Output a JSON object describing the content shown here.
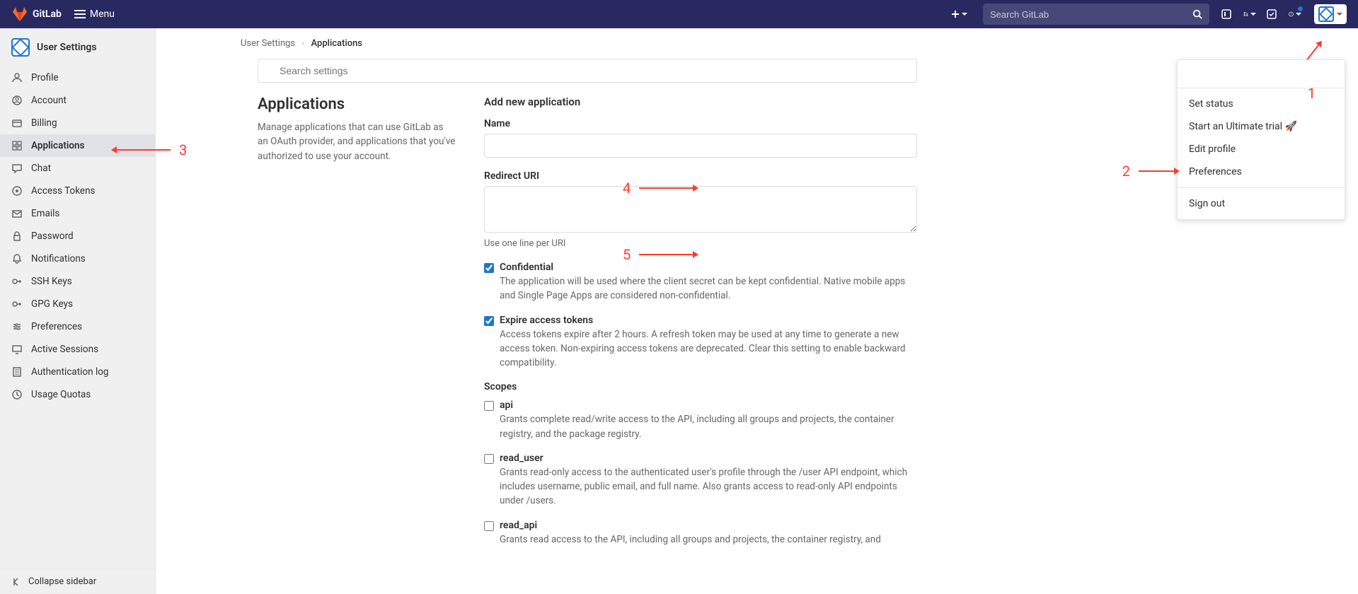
{
  "brand": "GitLab",
  "menu_label": "Menu",
  "search_placeholder": "Search GitLab",
  "sidebar": {
    "title": "User Settings",
    "items": [
      {
        "label": "Profile",
        "icon": "profile"
      },
      {
        "label": "Account",
        "icon": "account"
      },
      {
        "label": "Billing",
        "icon": "billing"
      },
      {
        "label": "Applications",
        "icon": "applications",
        "active": true
      },
      {
        "label": "Chat",
        "icon": "chat"
      },
      {
        "label": "Access Tokens",
        "icon": "token"
      },
      {
        "label": "Emails",
        "icon": "email"
      },
      {
        "label": "Password",
        "icon": "lock"
      },
      {
        "label": "Notifications",
        "icon": "bell"
      },
      {
        "label": "SSH Keys",
        "icon": "key"
      },
      {
        "label": "GPG Keys",
        "icon": "key"
      },
      {
        "label": "Preferences",
        "icon": "prefs"
      },
      {
        "label": "Active Sessions",
        "icon": "monitor"
      },
      {
        "label": "Authentication log",
        "icon": "list"
      },
      {
        "label": "Usage Quotas",
        "icon": "quota"
      }
    ],
    "collapse": "Collapse sidebar"
  },
  "breadcrumb": {
    "parent": "User Settings",
    "current": "Applications"
  },
  "search_settings_placeholder": "Search settings",
  "page": {
    "title": "Applications",
    "description": "Manage applications that can use GitLab as an OAuth provider, and applications that you've authorized to use your account.",
    "form_title": "Add new application",
    "name_label": "Name",
    "redirect_label": "Redirect URI",
    "redirect_hint": "Use one line per URI",
    "confidential": {
      "label": "Confidential",
      "desc": "The application will be used where the client secret can be kept confidential. Native mobile apps and Single Page Apps are considered non-confidential."
    },
    "expire": {
      "label": "Expire access tokens",
      "desc": "Access tokens expire after 2 hours. A refresh token may be used at any time to generate a new access token. Non-expiring access tokens are deprecated. Clear this setting to enable backward compatibility."
    },
    "scopes_title": "Scopes",
    "scopes": [
      {
        "name": "api",
        "desc": "Grants complete read/write access to the API, including all groups and projects, the container registry, and the package registry."
      },
      {
        "name": "read_user",
        "desc": "Grants read-only access to the authenticated user's profile through the /user API endpoint, which includes username, public email, and full name. Also grants access to read-only API endpoints under /users."
      },
      {
        "name": "read_api",
        "desc": "Grants read access to the API, including all groups and projects, the container registry, and"
      }
    ]
  },
  "dropdown": {
    "set_status": "Set status",
    "start_trial": "Start an Ultimate trial 🚀",
    "edit_profile": "Edit profile",
    "preferences": "Preferences",
    "sign_out": "Sign out"
  },
  "annotations": {
    "n1": "1",
    "n2": "2",
    "n3": "3",
    "n4": "4",
    "n5": "5"
  }
}
